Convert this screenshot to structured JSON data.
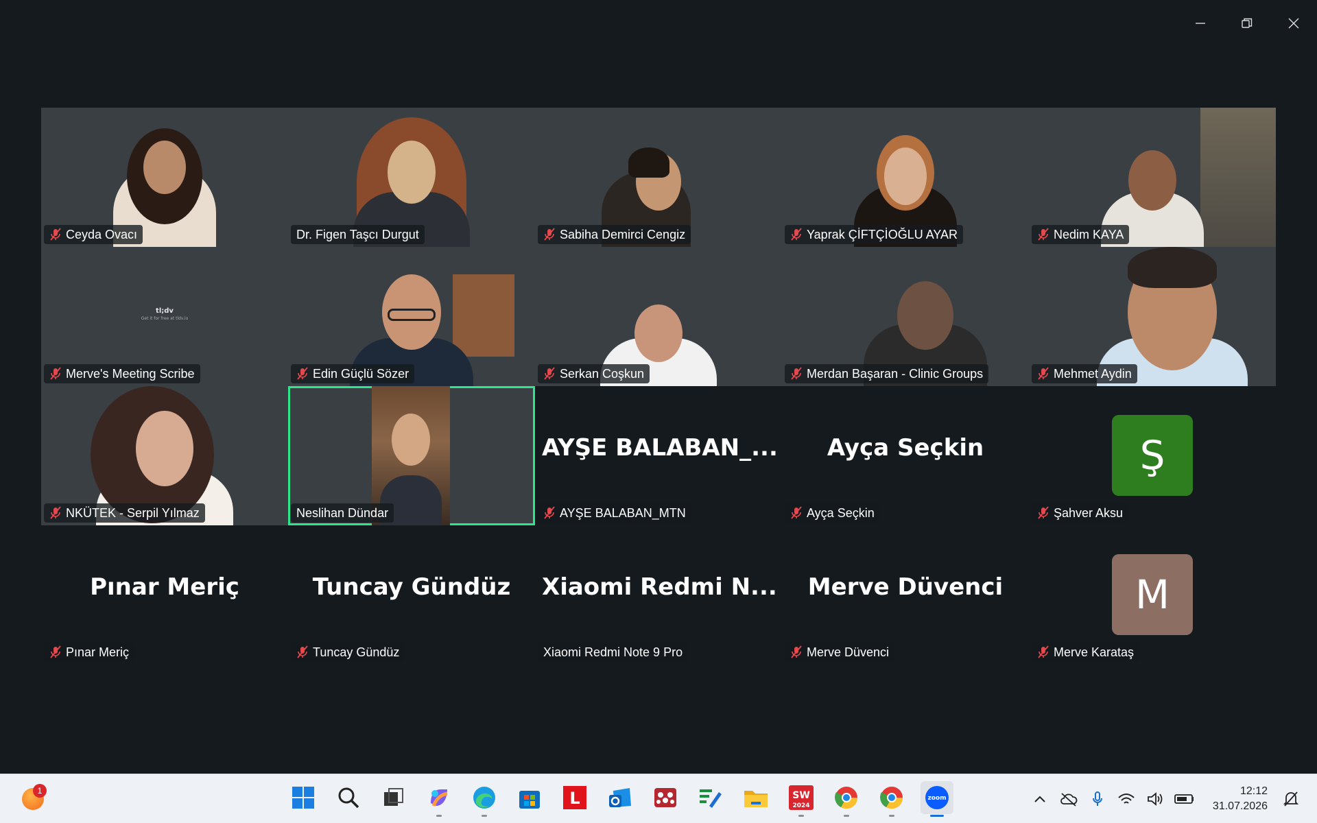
{
  "participants": [
    {
      "name": "Ceyda Ovacı",
      "muted": true
    },
    {
      "name": "Dr. Figen Taşcı Durgut",
      "muted": false
    },
    {
      "name": "Sabiha Demirci Cengiz",
      "muted": true
    },
    {
      "name": "Yaprak ÇİFTÇİOĞLU AYAR",
      "muted": true
    },
    {
      "name": "Nedim KAYA",
      "muted": true
    },
    {
      "name": "Merve's Meeting Scribe",
      "muted": true
    },
    {
      "name": "Edin Güçlü Sözer",
      "muted": true
    },
    {
      "name": "Serkan Coşkun",
      "muted": true
    },
    {
      "name": "Merdan Başaran - Clinic Groups",
      "muted": true
    },
    {
      "name": "Mehmet Aydin",
      "muted": true
    },
    {
      "name": "NKÜTEK - Serpil Yılmaz",
      "muted": true
    },
    {
      "name": "Neslihan Dündar",
      "muted": false
    },
    {
      "name": "AYŞE BALABAN_MTN",
      "muted": true,
      "display": "AYŞE  BALABAN_..."
    },
    {
      "name": "Ayça Seçkin",
      "muted": true,
      "display": "Ayça Seçkin"
    },
    {
      "name": "Şahver Aksu",
      "muted": true,
      "avatar_letter": "Ş",
      "avatar_color": "#2e7d1e"
    },
    {
      "name": "Pınar Meriç",
      "muted": true,
      "display": "Pınar Meriç"
    },
    {
      "name": "Tuncay Gündüz",
      "muted": true,
      "display": "Tuncay Gündüz"
    },
    {
      "name": "Xiaomi Redmi Note 9 Pro",
      "muted": false,
      "display": "Xiaomi  Redmi  N..."
    },
    {
      "name": "Merve Düvenci",
      "muted": true,
      "display": "Merve Düvenci"
    },
    {
      "name": "Merve Karataş",
      "muted": true,
      "avatar_letter": "M",
      "avatar_color": "#8d6e63"
    }
  ],
  "scribe": {
    "brand": "tl;dv",
    "sub": "Get it for free at tldv.io"
  },
  "taskbar": {
    "notification_count": "1",
    "apps": [
      "windows-start",
      "search",
      "task-view",
      "copilot",
      "edge",
      "store",
      "lexpera",
      "outlook",
      "mendeley",
      "editor",
      "file-explorer",
      "solidworks-2024",
      "chrome",
      "chrome-profile",
      "zoom"
    ],
    "solidworks_label": "SW",
    "solidworks_year": "2024",
    "zoom_label": "zoom",
    "time": "12:12",
    "date": "31.07.2026"
  },
  "colors": {
    "active_speaker": "#2ee58a",
    "background": "#141a1e",
    "muted_icon": "#e5484d"
  }
}
